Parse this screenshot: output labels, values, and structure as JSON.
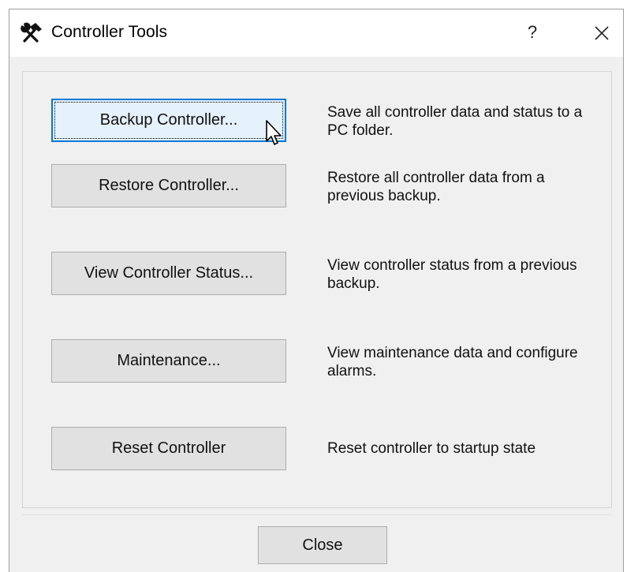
{
  "window": {
    "title": "Controller Tools",
    "help_label": "?"
  },
  "actions": [
    {
      "button_label": "Backup Controller...",
      "description": "Save all controller data and status to a PC folder."
    },
    {
      "button_label": "Restore Controller...",
      "description": "Restore all controller data from a previous backup."
    },
    {
      "button_label": "View Controller Status...",
      "description": "View controller status from a previous backup."
    },
    {
      "button_label": "Maintenance...",
      "description": "View maintenance data and configure alarms."
    },
    {
      "button_label": "Reset Controller",
      "description": "Reset controller to startup state"
    }
  ],
  "footer": {
    "close_label": "Close"
  },
  "icons": {
    "app": "hammer-wrench-icon",
    "close": "close-icon",
    "cursor": "mouse-pointer-icon"
  },
  "colors": {
    "focus_border": "#0078d7",
    "focus_fill": "#e5f1fb",
    "button_fill": "#e1e1e1",
    "dialog_bg": "#f0f0f0"
  }
}
